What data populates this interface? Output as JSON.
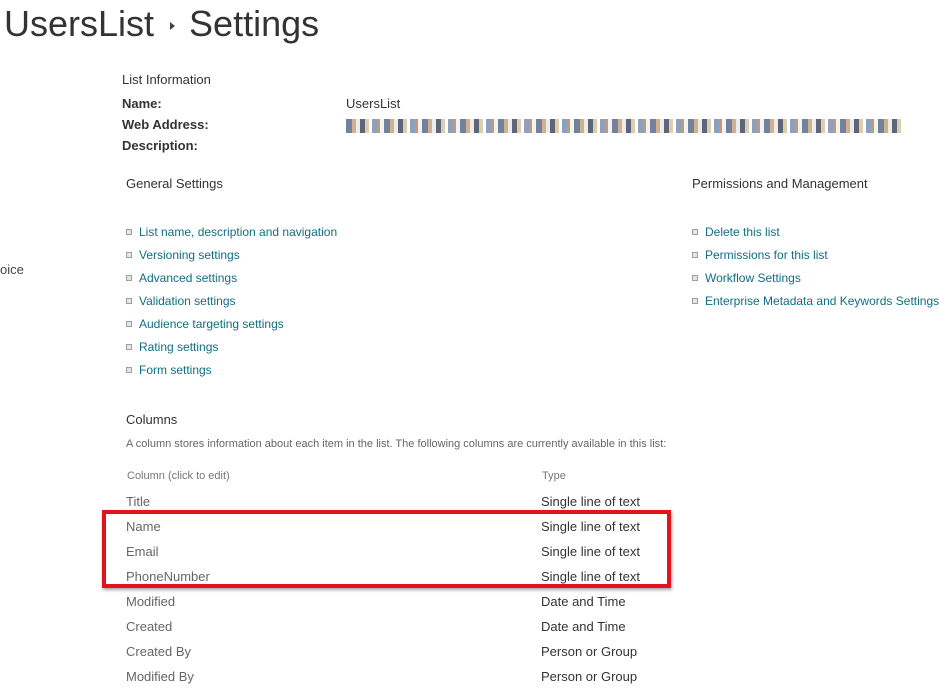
{
  "header": {
    "list_name": "UsersList",
    "page_name": "Settings"
  },
  "left_nav_fragment": "oice",
  "list_information": {
    "heading": "List Information",
    "name_label": "Name:",
    "name_value": "UsersList",
    "web_address_label": "Web Address:",
    "description_label": "Description:"
  },
  "general_settings": {
    "heading": "General Settings",
    "links": [
      "List name, description and navigation",
      "Versioning settings",
      "Advanced settings",
      "Validation settings",
      "Audience targeting settings",
      "Rating settings",
      "Form settings"
    ]
  },
  "permissions": {
    "heading": "Permissions and Management",
    "links": [
      "Delete this list",
      "Permissions for this list",
      "Workflow Settings",
      "Enterprise Metadata and Keywords Settings"
    ]
  },
  "columns": {
    "heading": "Columns",
    "description": "A column stores information about each item in the list. The following columns are currently available in this list:",
    "column_header": "Column (click to edit)",
    "type_header": "Type",
    "rows": [
      {
        "name": "Title",
        "type": "Single line of text"
      },
      {
        "name": "Name",
        "type": "Single line of text"
      },
      {
        "name": "Email",
        "type": "Single line of text"
      },
      {
        "name": "PhoneNumber",
        "type": "Single line of text"
      },
      {
        "name": "Modified",
        "type": "Date and Time"
      },
      {
        "name": "Created",
        "type": "Date and Time"
      },
      {
        "name": "Created By",
        "type": "Person or Group"
      },
      {
        "name": "Modified By",
        "type": "Person or Group"
      }
    ]
  },
  "colors": {
    "link": "#0f6e82",
    "highlight": "#e2131c"
  }
}
